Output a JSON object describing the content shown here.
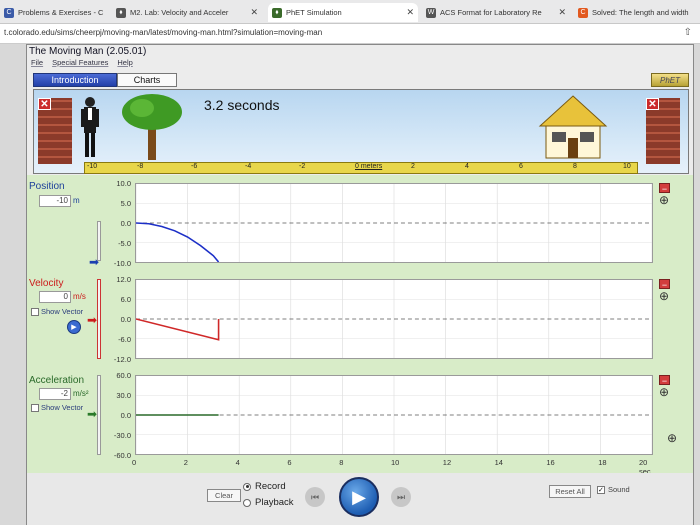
{
  "browser": {
    "tabs": [
      {
        "label": "Problems & Exercises - C",
        "fav": "C",
        "fav_color": "#3b5ba8"
      },
      {
        "label": "M2. Lab: Velocity and Acceler",
        "fav": "⬧",
        "fav_color": "#444"
      },
      {
        "label": "PhET Simulation",
        "fav": "⬧",
        "fav_color": "#3a6a2a"
      },
      {
        "label": "ACS Format for Laboratory Re",
        "fav": "W",
        "fav_color": "#444"
      },
      {
        "label": "Solved: The length and width",
        "fav": "C",
        "fav_color": "#e2591f"
      }
    ],
    "url": "t.colorado.edu/sims/cheerpj/moving-man/latest/moving-man.html?simulation=moving-man"
  },
  "app": {
    "title": "The Moving Man (2.05.01)",
    "menu": [
      "File",
      "Special Features",
      "Help"
    ],
    "tabs": {
      "intro": "Introduction",
      "charts": "Charts"
    },
    "logo": "PhET"
  },
  "playarea": {
    "time_label": "3.2 seconds",
    "ruler_ticks": [
      "-10",
      "-8",
      "-6",
      "-4",
      "-2",
      "0 meters",
      "2",
      "4",
      "6",
      "8",
      "10"
    ]
  },
  "position": {
    "label": "Position",
    "value": "-10",
    "unit": "m",
    "yticks": [
      "10.0",
      "5.0",
      "0.0",
      "-5.0",
      "-10.0"
    ]
  },
  "velocity": {
    "label": "Velocity",
    "value": "0",
    "unit": "m/s",
    "show_vector": "Show Vector",
    "yticks": [
      "12.0",
      "6.0",
      "0.0",
      "-6.0",
      "-12.0"
    ]
  },
  "acceleration": {
    "label": "Acceleration",
    "value": "-2",
    "unit": "m/s²",
    "show_vector": "Show Vector",
    "yticks": [
      "60.0",
      "30.0",
      "0.0",
      "-30.0",
      "-60.0"
    ]
  },
  "xaxis": {
    "ticks": [
      "0",
      "2",
      "4",
      "6",
      "8",
      "10",
      "12",
      "14",
      "16",
      "18",
      "20 sec"
    ]
  },
  "controls": {
    "clear": "Clear",
    "record": "Record",
    "playback": "Playback",
    "reset_all": "Reset All",
    "sound": "Sound"
  },
  "chart_data": [
    {
      "type": "line",
      "title": "",
      "ylabel": "Position",
      "xlim": [
        0,
        20
      ],
      "ylim": [
        -10,
        10
      ],
      "series": [
        {
          "x": [
            0,
            0.5,
            1,
            1.5,
            2,
            2.5,
            3,
            3.2
          ],
          "y": [
            0,
            -0.2,
            -0.9,
            -2.0,
            -3.6,
            -5.8,
            -8.4,
            -10
          ]
        }
      ],
      "color": "#1c2fc7"
    },
    {
      "type": "line",
      "title": "",
      "ylabel": "Velocity",
      "xlim": [
        0,
        20
      ],
      "ylim": [
        -12,
        12
      ],
      "series": [
        {
          "x": [
            0,
            3.2,
            3.2
          ],
          "y": [
            0,
            -6.4,
            0
          ]
        }
      ],
      "color": "#d02828"
    },
    {
      "type": "line",
      "title": "",
      "ylabel": "Acceleration",
      "xlim": [
        0,
        20
      ],
      "ylim": [
        -60,
        60
      ],
      "series": [
        {
          "x": [
            0,
            3.2
          ],
          "y": [
            0,
            0
          ]
        }
      ],
      "color": "#2a6a2a"
    }
  ]
}
